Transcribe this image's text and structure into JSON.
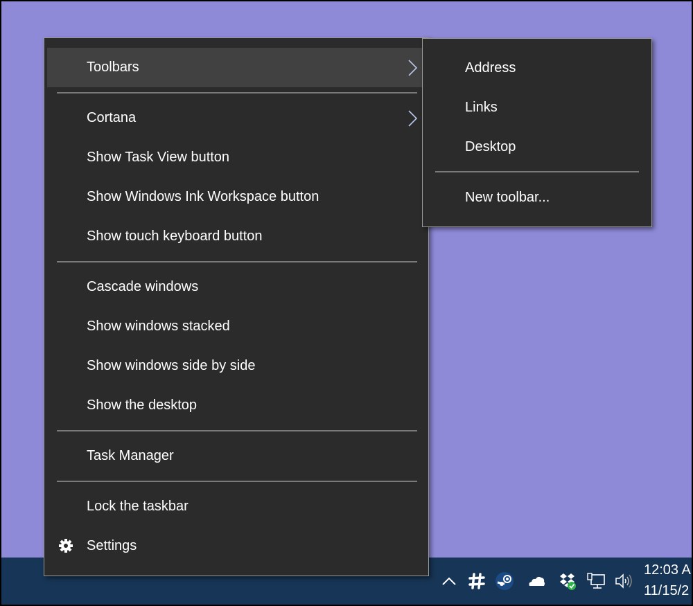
{
  "context_menu": {
    "items": [
      {
        "label": "Toolbars",
        "has_submenu": true,
        "highlighted": true
      },
      {
        "label": "Cortana",
        "has_submenu": true
      },
      {
        "label": "Show Task View button"
      },
      {
        "label": "Show Windows Ink Workspace button"
      },
      {
        "label": "Show touch keyboard button"
      },
      {
        "label": "Cascade windows"
      },
      {
        "label": "Show windows stacked"
      },
      {
        "label": "Show windows side by side"
      },
      {
        "label": "Show the desktop"
      },
      {
        "label": "Task Manager"
      },
      {
        "label": "Lock the taskbar"
      },
      {
        "label": "Settings",
        "icon": "gear-icon"
      }
    ]
  },
  "toolbars_submenu": {
    "items": [
      {
        "label": "Address"
      },
      {
        "label": "Links"
      },
      {
        "label": "Desktop"
      },
      {
        "label": "New toolbar..."
      }
    ]
  },
  "taskbar": {
    "tray_icons": [
      "show-hidden-icons-chevron",
      "slack-icon",
      "steam-icon",
      "onedrive-icon",
      "dropbox-icon",
      "network-icon",
      "volume-icon"
    ],
    "time": "12:03 A",
    "date": "11/15/2"
  },
  "colors": {
    "desktop": "#8f8ad8",
    "taskbar": "#173556",
    "menu_bg": "#2b2b2b",
    "menu_highlight": "#414141",
    "dropbox_check": "#2fb34a"
  }
}
